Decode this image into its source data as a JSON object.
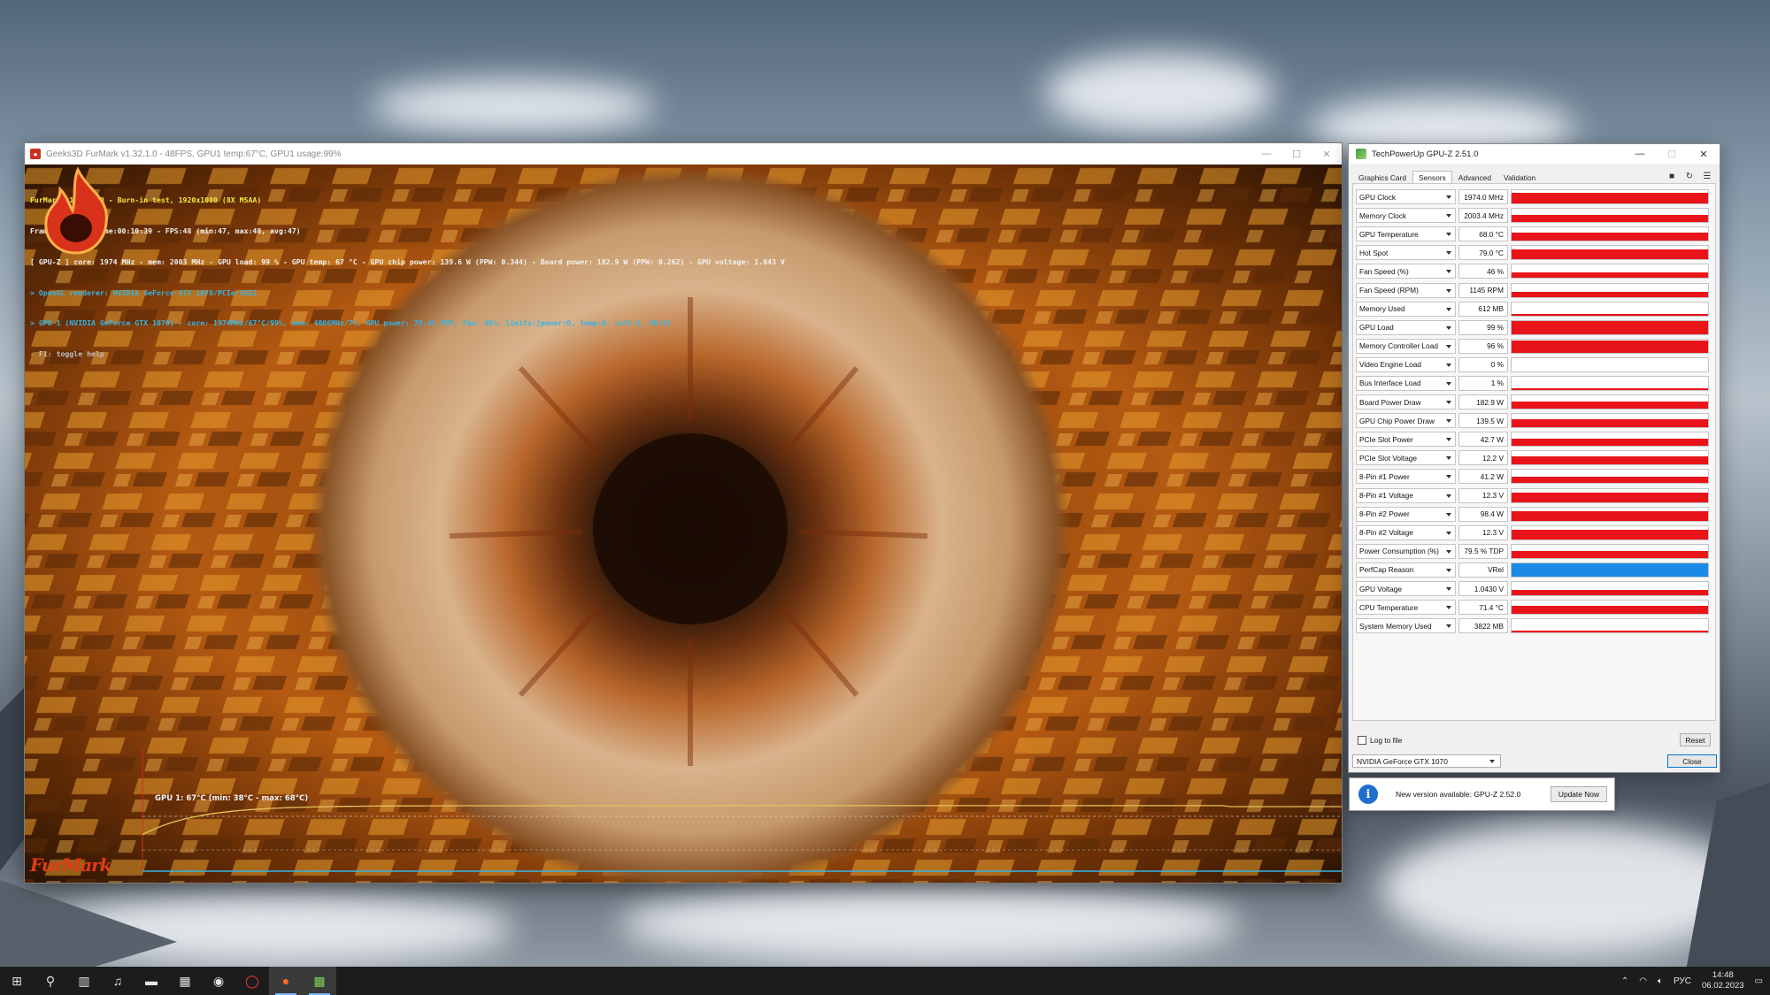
{
  "furmark": {
    "title": "Geeks3D FurMark v1.32.1.0 - 48FPS, GPU1 temp:67°C, GPU1 usage:99%",
    "overlay": {
      "line1": "FurMark v1.32.1.0 - Burn-in test, 1920x1080 (8X MSAA)",
      "line2": "Frames:30356 - time:00:10:39 - FPS:48 (min:47, max:48, avg:47)",
      "line3": "[ GPU-Z ] core: 1974 MHz - mem: 2003 MHz - GPU load: 99 % - GPU temp: 67 °C - GPU chip power: 139.6 W (PPW: 0.344) - Board power: 182.9 W (PPW: 0.262) - GPU voltage: 1.043 V",
      "line4": "> OpenGL renderer: NVIDIA GeForce GTX 1070/PCIe/SSE2",
      "line5": "> GPU 1 (NVIDIA GeForce GTX 1070) - core: 1974MHz/67°C/99%, mem: 4006MHz/7%, GPU power: 79.4% TDP, fan: 46%, limits:[power:0, temp:0, volt:1, OV:0]",
      "line6": "- F1: toggle help"
    },
    "graph_label": "GPU 1: 67°C (min: 38°C - max: 68°C)",
    "logo_text": "FurMark",
    "temp_graph": {
      "min": 38,
      "max": 68,
      "current": 67
    }
  },
  "gpuz": {
    "title": "TechPowerUp GPU-Z 2.51.0",
    "tabs": [
      {
        "label": "Graphics Card",
        "active": false
      },
      {
        "label": "Sensors",
        "active": true
      },
      {
        "label": "Advanced",
        "active": false
      },
      {
        "label": "Validation",
        "active": false
      }
    ],
    "sensors": [
      {
        "label": "GPU Clock",
        "value": "1974.0 MHz",
        "fill": 0.82,
        "color": "#e8141a"
      },
      {
        "label": "Memory Clock",
        "value": "2003.4 MHz",
        "fill": 0.5,
        "color": "#e8141a"
      },
      {
        "label": "GPU Temperature",
        "value": "68.0 °C",
        "fill": 0.62,
        "color": "#e8141a"
      },
      {
        "label": "Hot Spot",
        "value": "79.0 °C",
        "fill": 0.7,
        "color": "#e8141a"
      },
      {
        "label": "Fan Speed (%)",
        "value": "46 %",
        "fill": 0.42,
        "color": "#e8141a"
      },
      {
        "label": "Fan Speed (RPM)",
        "value": "1145 RPM",
        "fill": 0.4,
        "color": "#e8141a"
      },
      {
        "label": "Memory Used",
        "value": "612 MB",
        "fill": 0.1,
        "color": "#e8141a"
      },
      {
        "label": "GPU Load",
        "value": "99 %",
        "fill": 0.99,
        "color": "#e8141a"
      },
      {
        "label": "Memory Controller Load",
        "value": "96 %",
        "fill": 0.96,
        "color": "#e8141a"
      },
      {
        "label": "Video Engine Load",
        "value": "0 %",
        "fill": 0,
        "color": "#e8141a"
      },
      {
        "label": "Bus Interface Load",
        "value": "1 %",
        "fill": 0.01,
        "color": "#e8141a"
      },
      {
        "label": "Board Power Draw",
        "value": "182.9 W",
        "fill": 0.55,
        "color": "#e8141a"
      },
      {
        "label": "GPU Chip Power Draw",
        "value": "139.5 W",
        "fill": 0.6,
        "color": "#e8141a"
      },
      {
        "label": "PCIe Slot Power",
        "value": "42.7 W",
        "fill": 0.5,
        "color": "#e8141a"
      },
      {
        "label": "PCIe Slot Voltage",
        "value": "12.2 V",
        "fill": 0.6,
        "color": "#e8141a"
      },
      {
        "label": "8-Pin #1 Power",
        "value": "41.2 W",
        "fill": 0.45,
        "color": "#e8141a"
      },
      {
        "label": "8-Pin #1 Voltage",
        "value": "12.3 V",
        "fill": 0.72,
        "color": "#e8141a"
      },
      {
        "label": "8-Pin #2 Power",
        "value": "98.4 W",
        "fill": 0.72,
        "color": "#e8141a"
      },
      {
        "label": "8-Pin #2 Voltage",
        "value": "12.3 V",
        "fill": 0.72,
        "color": "#e8141a"
      },
      {
        "label": "Power Consumption (%)",
        "value": "79.5 % TDP",
        "fill": 0.55,
        "color": "#e8141a"
      },
      {
        "label": "PerfCap Reason",
        "value": "VRel",
        "fill": 1,
        "color": "#1a8ae6"
      },
      {
        "label": "GPU Voltage",
        "value": "1.0430 V",
        "fill": 0.4,
        "color": "#e8141a"
      },
      {
        "label": "CPU Temperature",
        "value": "71.4 °C",
        "fill": 0.6,
        "color": "#e8141a"
      },
      {
        "label": "System Memory Used",
        "value": "3822 MB",
        "fill": 0.1,
        "color": "#e8141a"
      }
    ],
    "log_label": "Log to file",
    "reset_label": "Reset",
    "gpu_select": "NVIDIA GeForce GTX 1070",
    "close_label": "Close"
  },
  "update": {
    "text": "New version available: GPU-Z 2.52.0",
    "button": "Update Now"
  },
  "taskbar": {
    "icons": [
      "windows-start-icon",
      "search-icon",
      "task-view-icon",
      "music-player-icon",
      "file-explorer-icon",
      "calculator-icon",
      "steam-icon",
      "opera-icon",
      "furmark-icon",
      "gpuz-icon"
    ],
    "language": "РУС",
    "time": "14:48",
    "date": "06.02.2023"
  }
}
